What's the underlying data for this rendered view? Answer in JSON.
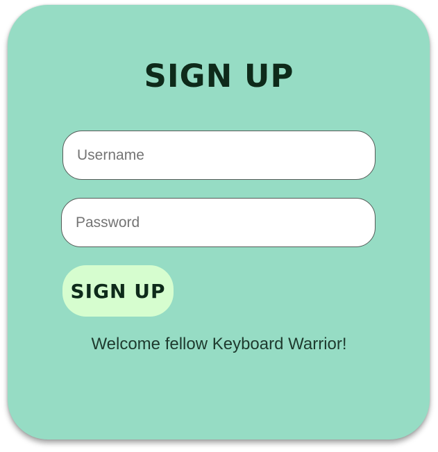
{
  "form": {
    "title": "SIGN UP",
    "username_placeholder": "Username",
    "username_value": "",
    "password_placeholder": "Password",
    "password_value": "",
    "submit_label": "SIGN UP",
    "welcome_text": "Welcome fellow Keyboard Warrior!"
  },
  "colors": {
    "card_background": "#96dcc4",
    "button_background": "#d6fdcf",
    "text_dark": "#0e2a1a",
    "input_background": "#ffffff"
  }
}
